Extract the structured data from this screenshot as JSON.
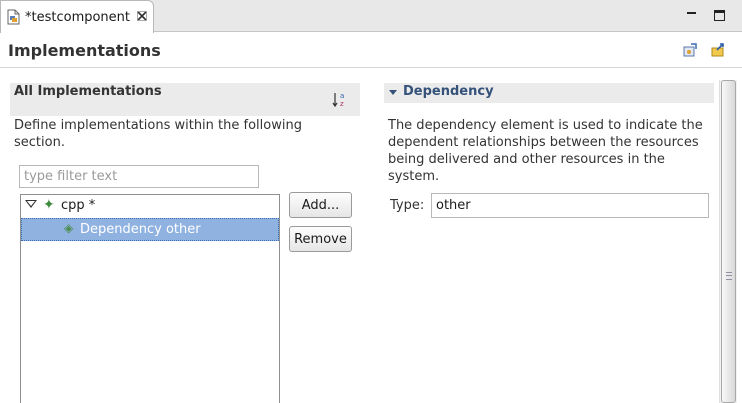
{
  "editor": {
    "tab_title": "*testcomponent",
    "tab_icon": "component-file-icon",
    "close_icon": "close-icon",
    "minimize_icon": "minimize-icon",
    "maximize_icon": "maximize-icon"
  },
  "form": {
    "title": "Implementations",
    "header_icons": [
      "generate-code-icon",
      "export-icon"
    ]
  },
  "implementations_section": {
    "title": "All Implementations",
    "sort_icon": "sort-alphabetical-icon",
    "description": "Define implementations within the following section.",
    "filter_placeholder": "type filter text",
    "filter_value": "",
    "tree": [
      {
        "label": "cpp *",
        "icon": "implementation-icon",
        "expanded": true,
        "selected": false
      },
      {
        "label": "Dependency other",
        "icon": "dependency-icon",
        "expanded": false,
        "selected": true
      }
    ],
    "buttons": {
      "add": "Add...",
      "remove": "Remove"
    }
  },
  "dependency_section": {
    "title": "Dependency",
    "expanded": true,
    "description": "The dependency element is used to indicate the dependent relationships between the resources being delivered and other resources in the system.",
    "type_label": "Type:",
    "type_value": "other"
  },
  "colors": {
    "selection": "#8fb2e0",
    "section_header_bg": "#ebebeb",
    "section_title_accent": "#35527a"
  }
}
